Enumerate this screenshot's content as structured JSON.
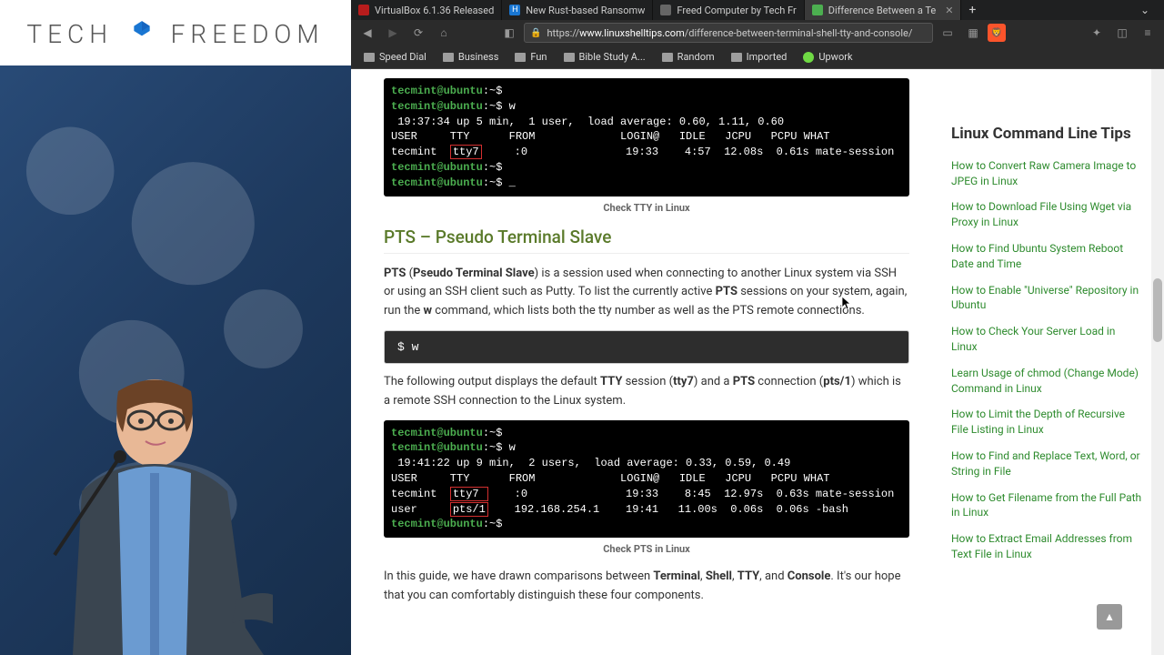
{
  "browser": {
    "tabs": [
      {
        "title": "VirtualBox 6.1.36 Released",
        "fav": "#b71c1c",
        "active": false
      },
      {
        "title": "New Rust-based Ransomw",
        "fav": "#1976d2",
        "active": false
      },
      {
        "title": "Freed Computer by Tech Fr",
        "fav": "#666",
        "active": false
      },
      {
        "title": "Difference Between a Te",
        "fav": "#4caf50",
        "active": true
      }
    ],
    "url_prefix": "https://",
    "url_host": "www.linuxshelltips.com",
    "url_path": "/difference-between-terminal-shell-tty-and-console/",
    "bookmarks": [
      "Speed Dial",
      "Business",
      "Fun",
      "Bible Study A...",
      "Random",
      "Imported",
      "Upwork"
    ]
  },
  "logo": "TECH   FREEDOM",
  "article": {
    "term1_lines": [
      {
        "p": "tecmint@ubuntu",
        "t": ":~$"
      },
      {
        "p": "tecmint@ubuntu",
        "t": ":~$ w"
      },
      {
        "raw": " 19:37:34 up 5 min,  1 user,  load average: 0.60, 1.11, 0.60"
      },
      {
        "raw": "USER     TTY      FROM             LOGIN@   IDLE   JCPU   PCPU WHAT"
      },
      {
        "raw_pre": "tecmint  ",
        "hl": "tty7",
        "raw_post": "     :0               19:33    4:57  12.08s  0.61s mate-session"
      },
      {
        "p": "tecmint@ubuntu",
        "t": ":~$"
      },
      {
        "p": "tecmint@ubuntu",
        "t": ":~$ _"
      }
    ],
    "cap1": "Check TTY in Linux",
    "h2": "PTS – Pseudo Terminal Slave",
    "p1a": "PTS",
    "p1b": " (",
    "p1c": "Pseudo Terminal Slave",
    "p1d": ") is a session used when connecting to another Linux system via SSH or using an SSH client such as Putty. To list the currently active ",
    "p1e": "PTS",
    "p1f": " sessions on your system, again, run the ",
    "p1g": "w",
    "p1h": " command, which lists both the tty number as well as the PTS remote connections.",
    "code1": "$ w",
    "p2a": "The following output displays the default ",
    "p2b": "TTY",
    "p2c": " session (",
    "p2d": "tty7",
    "p2e": ") and a ",
    "p2f": "PTS",
    "p2g": " connection (",
    "p2h": "pts/1",
    "p2i": ") which is a remote SSH connection to the Linux system.",
    "term2_lines": [
      {
        "p": "tecmint@ubuntu",
        "t": ":~$"
      },
      {
        "p": "tecmint@ubuntu",
        "t": ":~$ w"
      },
      {
        "raw": " 19:41:22 up 9 min,  2 users,  load average: 0.33, 0.59, 0.49"
      },
      {
        "raw": "USER     TTY      FROM             LOGIN@   IDLE   JCPU   PCPU WHAT"
      },
      {
        "raw_pre": "tecmint  ",
        "hl": "tty7 ",
        "raw_post": "    :0               19:33    8:45  12.97s  0.63s mate-session"
      },
      {
        "raw_pre": "user     ",
        "hl": "pts/1",
        "raw_post": "    192.168.254.1    19:41   11.00s  0.06s  0.06s -bash"
      },
      {
        "p": "tecmint@ubuntu",
        "t": ":~$"
      }
    ],
    "cap2": "Check PTS in Linux",
    "p3a": "In this guide, we have drawn comparisons between ",
    "p3b": "Terminal",
    "p3c": ", ",
    "p3d": "Shell",
    "p3e": ", ",
    "p3f": "TTY",
    "p3g": ", and ",
    "p3h": "Console",
    "p3i": ". It's our hope that you can comfortably distinguish these four components."
  },
  "sidebar": {
    "title": "Linux Command Line Tips",
    "links": [
      "How to Convert Raw Camera Image to JPEG in Linux",
      "How to Download File Using Wget via Proxy in Linux",
      "How to Find Ubuntu System Reboot Date and Time",
      "How to Enable \"Universe\" Repository in Ubuntu",
      "How to Check Your Server Load in Linux",
      "Learn Usage of chmod (Change Mode) Command in Linux",
      "How to Limit the Depth of Recursive File Listing in Linux",
      "How to Find and Replace Text, Word, or String in File",
      "How to Get Filename from the Full Path in Linux",
      "How to Extract Email Addresses from Text File in Linux"
    ]
  }
}
